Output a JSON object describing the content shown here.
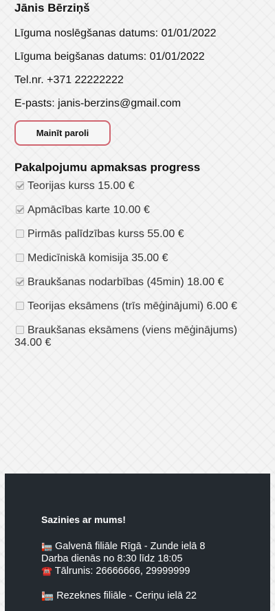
{
  "profile": {
    "name": "Jānis Bērziņš",
    "contract_start": "Līguma noslēgšanas datums: 01/01/2022",
    "contract_end": "Līguma beigšanas datums: 01/01/2022",
    "phone": "Tel.nr. +371 22222222",
    "email": "E-pasts: janis-berzins@gmail.com",
    "change_password_label": "Mainīt paroli"
  },
  "progress": {
    "title": "Pakalpojumu apmaksas progress",
    "items": [
      {
        "label": "Teorijas kurss 15.00 €",
        "checked": true
      },
      {
        "label": "Apmācības karte 10.00 €",
        "checked": true
      },
      {
        "label": "Pirmās palīdzības kurss 55.00 €",
        "checked": false
      },
      {
        "label": "Medicīniskā komisija 35.00 €",
        "checked": false
      },
      {
        "label": "Braukšanas nodarbības (45min) 18.00 €",
        "checked": true
      },
      {
        "label": "Teorijas eksāmens (trīs mēģinājumi) 6.00 €",
        "checked": false
      },
      {
        "label": "Braukšanas eksāmens (viens mēģinājums) 34.00 €",
        "checked": false
      }
    ]
  },
  "footer": {
    "title": "Sazinies ar mums!",
    "branch1_icon": "🏣",
    "branch1_address": "Galvenā filiāle Rīgā - Zunde ielā 8",
    "branch1_hours": "Darba dienās no 8:30 līdz 18:05",
    "branch1_phone_icon": "☎️",
    "branch1_phone": "Tālrunis: 26666666, 29999999",
    "branch2_icon": "🏣",
    "branch2_address": "Rezeknes filiāle - Ceriņu ielā 22"
  }
}
